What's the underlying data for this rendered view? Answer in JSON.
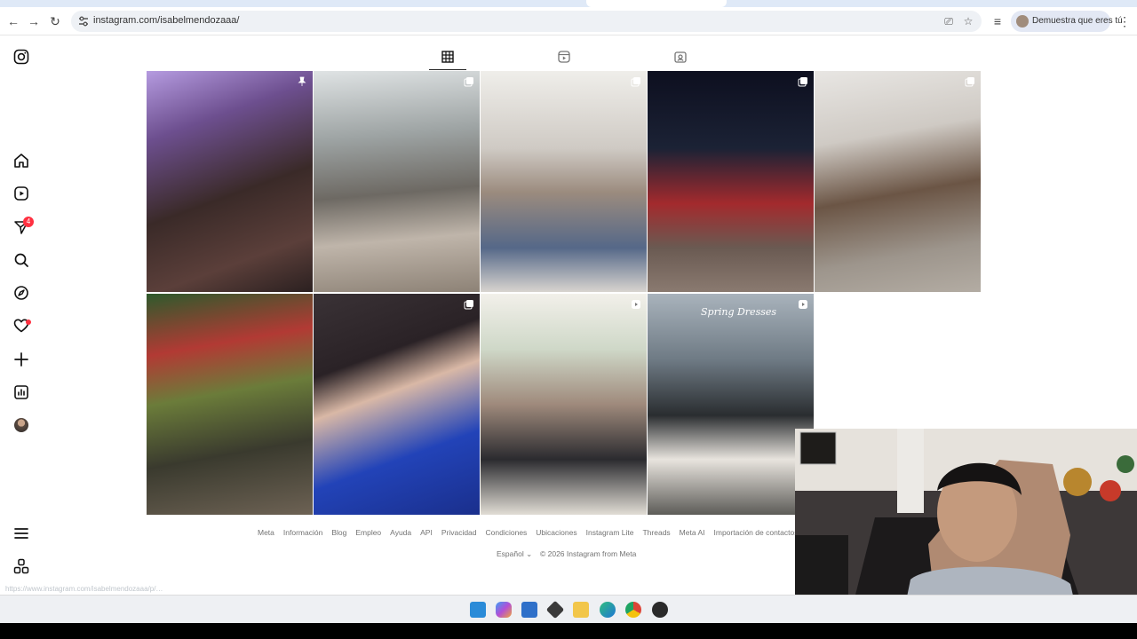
{
  "browser": {
    "url": "instagram.com/isabelmendozaaa/",
    "profile_label": "Demuestra que eres tú",
    "back_glyph": "←",
    "forward_glyph": "→",
    "reload_glyph": "↻",
    "menu_glyph": "⋮",
    "cast_glyph": "⎚",
    "bookmark_glyph": "☆",
    "queue_glyph": "≡"
  },
  "sidebar": {
    "items": [
      {
        "icon": "instagram-logo-icon"
      },
      {
        "icon": "home-icon"
      },
      {
        "icon": "reels-icon"
      },
      {
        "icon": "messages-icon",
        "badge": "4"
      },
      {
        "icon": "search-icon"
      },
      {
        "icon": "explore-icon"
      },
      {
        "icon": "notifications-icon"
      },
      {
        "icon": "create-icon"
      },
      {
        "icon": "dashboard-icon"
      },
      {
        "icon": "profile-avatar"
      },
      {
        "icon": "more-menu-icon"
      },
      {
        "icon": "also-from-meta-icon"
      }
    ]
  },
  "profile_tabs": [
    {
      "icon": "grid-icon",
      "active": true
    },
    {
      "icon": "reels-tab-icon",
      "active": false
    },
    {
      "icon": "tagged-icon",
      "active": false
    }
  ],
  "posts": [
    {
      "corner_icon": "pin-icon"
    },
    {
      "corner_icon": "carousel-icon"
    },
    {
      "corner_icon": "carousel-icon"
    },
    {
      "corner_icon": "carousel-icon"
    },
    {
      "corner_icon": "carousel-icon"
    },
    {
      "corner_icon": ""
    },
    {
      "corner_icon": "carousel-icon"
    },
    {
      "corner_icon": "reel-icon"
    },
    {
      "corner_icon": "reel-icon",
      "overlay_text": "Spring Dresses"
    }
  ],
  "footer": {
    "links": [
      "Meta",
      "Información",
      "Blog",
      "Empleo",
      "Ayuda",
      "API",
      "Privacidad",
      "Condiciones",
      "Ubicaciones",
      "Instagram Lite",
      "Threads",
      "Meta AI",
      "Importación de contactos y no usuarios"
    ],
    "language": "Español ⌄",
    "copyright": "© 2026 Instagram from Meta"
  },
  "status_url": "https://www.instagram.com/isabelmendozaaa/p/…",
  "taskbar": [
    "windows-start-icon",
    "copilot-icon",
    "store-icon",
    "app-icon",
    "file-explorer-icon",
    "edge-icon",
    "chrome-icon",
    "obs-icon"
  ],
  "colors": {
    "accent": "#0095f6",
    "notification": "#ff3040",
    "text_muted": "#737373"
  }
}
